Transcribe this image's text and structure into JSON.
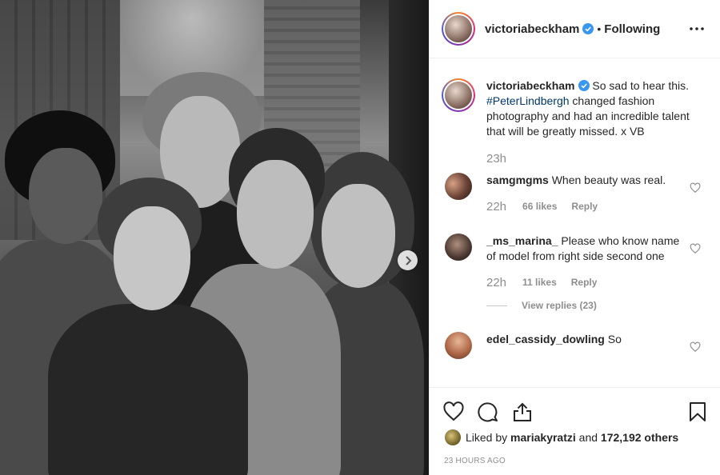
{
  "header": {
    "username": "victoriabeckham",
    "separator": "•",
    "follow_status": "Following"
  },
  "caption": {
    "username": "victoriabeckham",
    "text_before": "So sad to hear this.",
    "hashtag": "#PeterLindbergh",
    "text_after": "changed fashion photography and had an incredible talent that will be greatly missed. x VB",
    "time": "23h"
  },
  "comments": [
    {
      "username": "samgmgms",
      "text": "When beauty was real.",
      "time": "22h",
      "likes": "66 likes",
      "reply": "Reply"
    },
    {
      "username": "_ms_marina_",
      "text": "Please who know name of model from right side second one",
      "time": "22h",
      "likes": "11 likes",
      "reply": "Reply",
      "view_replies": "View replies (23)"
    },
    {
      "username": "edel_cassidy_dowling",
      "text": "So"
    }
  ],
  "footer": {
    "liked_prefix": "Liked by",
    "liked_user": "mariakyratzi",
    "liked_and": "and",
    "liked_count": "172,192 others",
    "timestamp": "23 HOURS AGO"
  },
  "icons": {
    "verified": "verified-badge-icon",
    "more": "more-options-icon",
    "next": "chevron-right-icon",
    "like": "heart-icon",
    "comment": "comment-bubble-icon",
    "share": "share-upload-icon",
    "save": "bookmark-icon"
  },
  "colors": {
    "verified_blue": "#3897f0",
    "hashtag": "#00376b",
    "muted": "#8e8e8e",
    "text": "#262626"
  }
}
